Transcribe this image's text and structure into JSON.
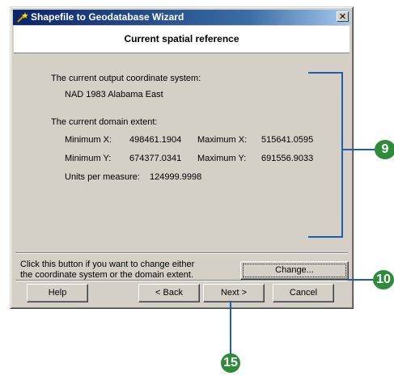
{
  "window": {
    "title": "Shapefile to Geodatabase Wizard",
    "close_glyph": "✕",
    "icon": "wizard-wand-icon"
  },
  "heading": "Current spatial reference",
  "coordinate_system": {
    "label": "The current output coordinate system:",
    "value": "NAD 1983 Alabama East"
  },
  "domain": {
    "label": "The current domain extent:",
    "min_x_label": "Minimum X:",
    "min_x": "498461.1904",
    "max_x_label": "Maximum X:",
    "max_x": "515641.0595",
    "min_y_label": "Minimum Y:",
    "min_y": "674377.0341",
    "max_y_label": "Maximum Y:",
    "max_y": "691556.9033",
    "units_label": "Units per measure:",
    "units": "124999.9998"
  },
  "change": {
    "text_line1": "Click this button if you want to change either",
    "text_line2": "the coordinate system or the domain extent.",
    "button_label": "Change..."
  },
  "buttons": {
    "help": "Help",
    "back": "< Back",
    "next": "Next >",
    "cancel": "Cancel"
  },
  "callouts": {
    "bracket_step": "9",
    "change_step": "10",
    "next_step": "15",
    "color": "#2e8b3a",
    "line_color": "#1f5fa8"
  }
}
